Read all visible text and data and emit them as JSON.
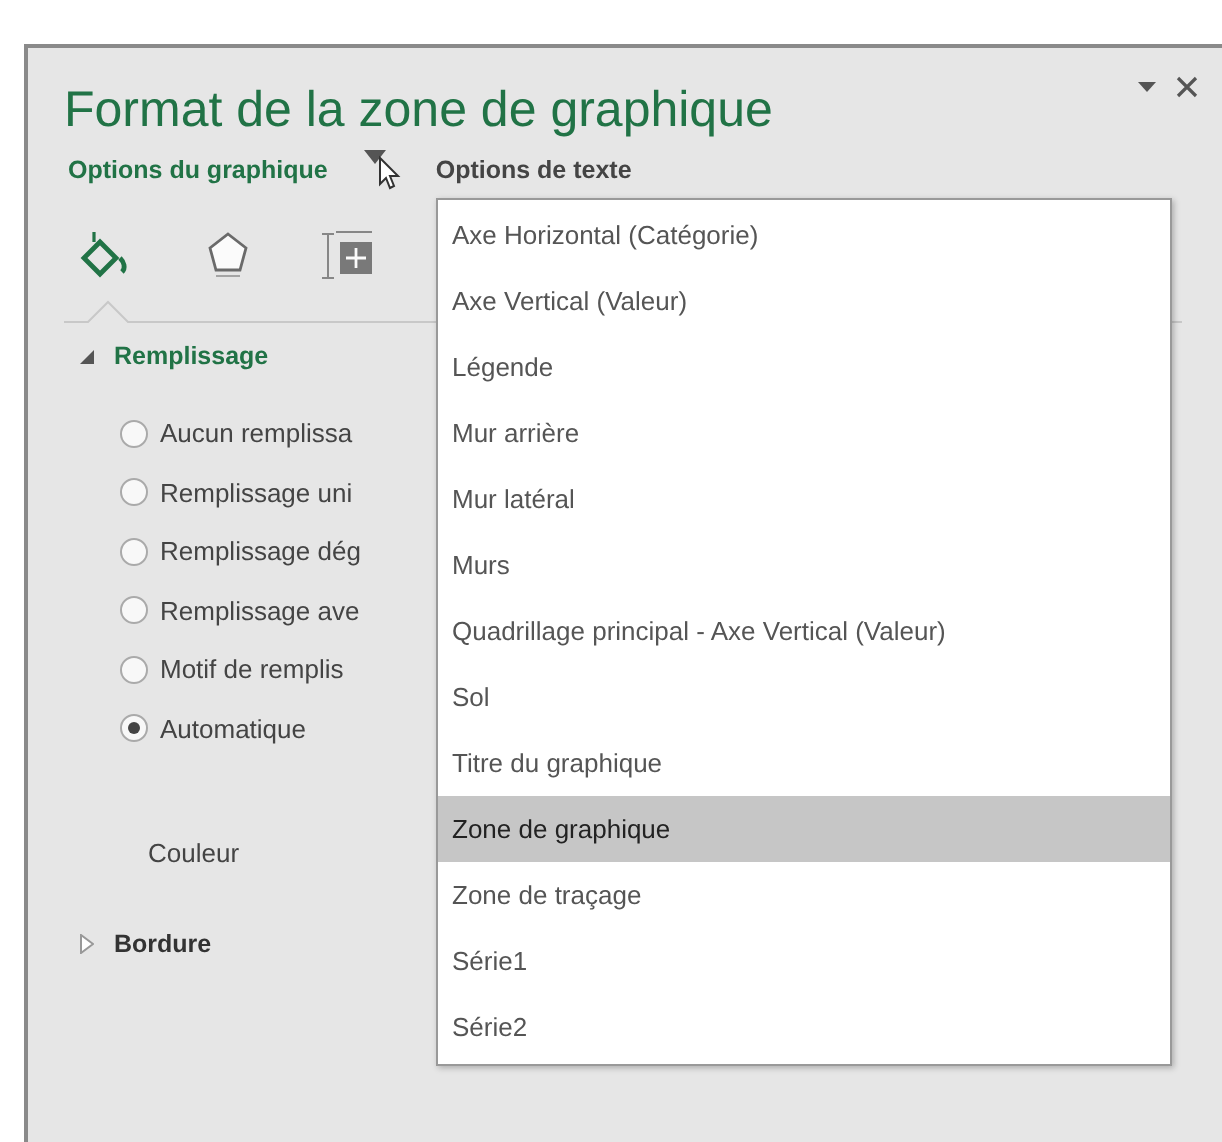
{
  "pane": {
    "title": "Format de la zone de graphique"
  },
  "tabs": [
    {
      "label": "Options du graphique",
      "selected": true
    },
    {
      "label": "Options de texte",
      "selected": false
    }
  ],
  "icon_tabs": [
    {
      "kind": "fill",
      "selected": true
    },
    {
      "kind": "shape",
      "selected": false
    },
    {
      "kind": "size",
      "selected": false
    }
  ],
  "sections": [
    {
      "title": "Remplissage",
      "expanded": true,
      "options": [
        {
          "label": "Aucun remplissa",
          "selected": false
        },
        {
          "label": "Remplissage uni",
          "selected": false
        },
        {
          "label": "Remplissage dég",
          "selected": false
        },
        {
          "label": "Remplissage ave",
          "selected": false
        },
        {
          "label": "Motif de remplis",
          "selected": false
        },
        {
          "label": "Automatique",
          "selected": true
        }
      ],
      "fields": [
        {
          "label": "Couleur"
        }
      ]
    },
    {
      "title": "Bordure",
      "expanded": false
    }
  ],
  "dropdown": {
    "items": [
      {
        "label": "Axe Horizontal (Catégorie)",
        "selected": false
      },
      {
        "label": "Axe Vertical (Valeur)",
        "selected": false
      },
      {
        "label": "Légende",
        "selected": false
      },
      {
        "label": "Mur arrière",
        "selected": false
      },
      {
        "label": "Mur latéral",
        "selected": false
      },
      {
        "label": "Murs",
        "selected": false
      },
      {
        "label": "Quadrillage principal - Axe Vertical (Valeur)",
        "selected": false
      },
      {
        "label": "Sol",
        "selected": false
      },
      {
        "label": "Titre du graphique",
        "selected": false
      },
      {
        "label": "Zone de graphique",
        "selected": true
      },
      {
        "label": "Zone de traçage",
        "selected": false
      },
      {
        "label": "Série1",
        "selected": false
      },
      {
        "label": "Série2",
        "selected": false
      }
    ]
  }
}
